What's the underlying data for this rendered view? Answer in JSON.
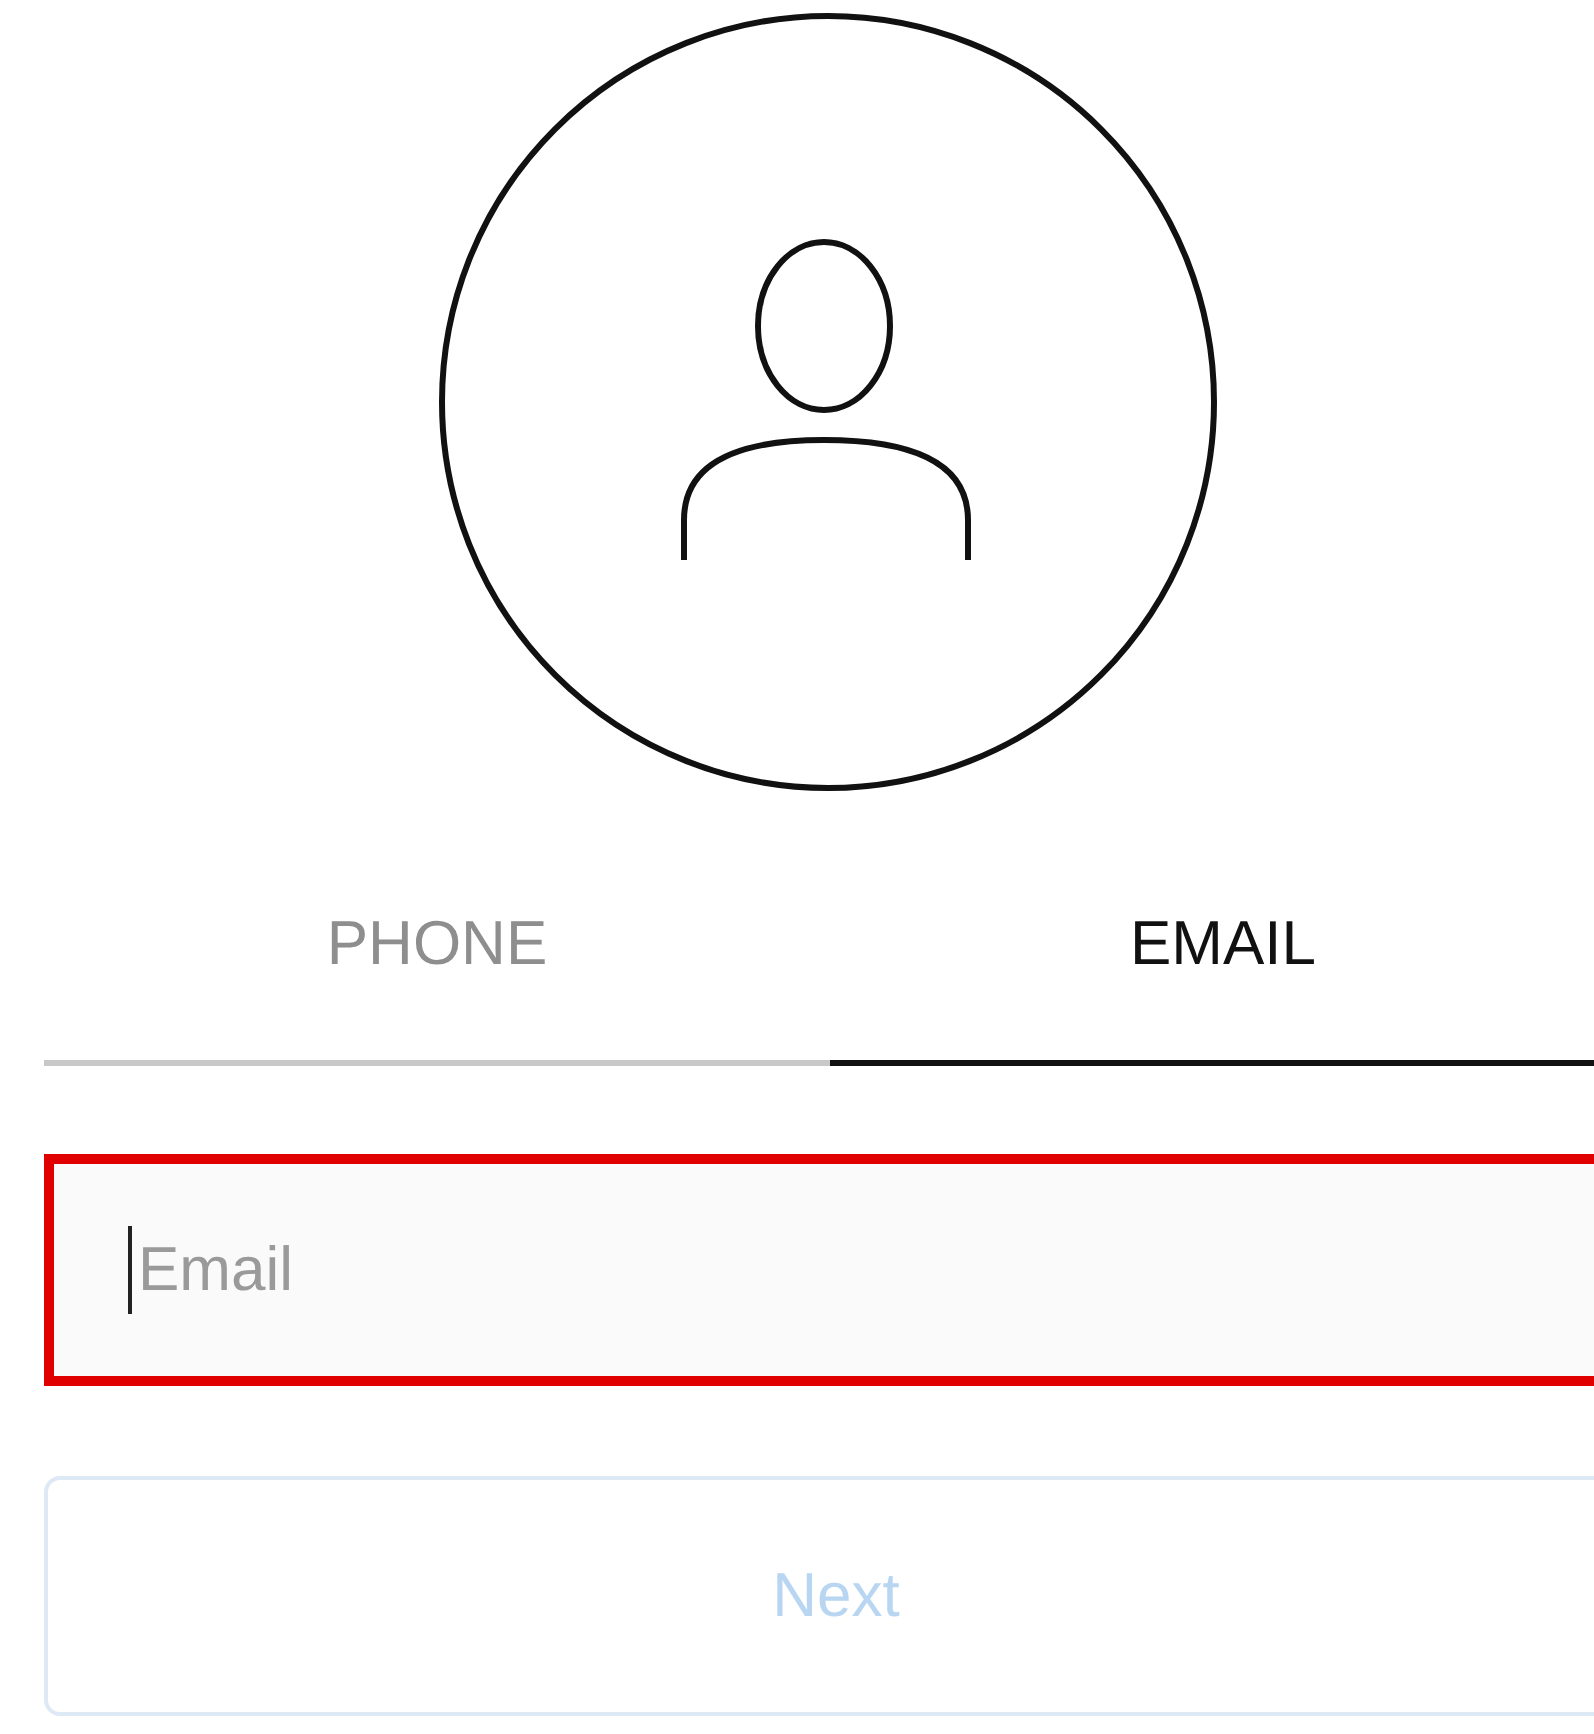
{
  "tabs": [
    {
      "label": "PHONE",
      "selected": false
    },
    {
      "label": "EMAIL",
      "selected": true
    }
  ],
  "email_field": {
    "placeholder": "Email",
    "highlighted": true,
    "focused": true
  },
  "next_button": {
    "label": "Next",
    "disabled": true
  }
}
